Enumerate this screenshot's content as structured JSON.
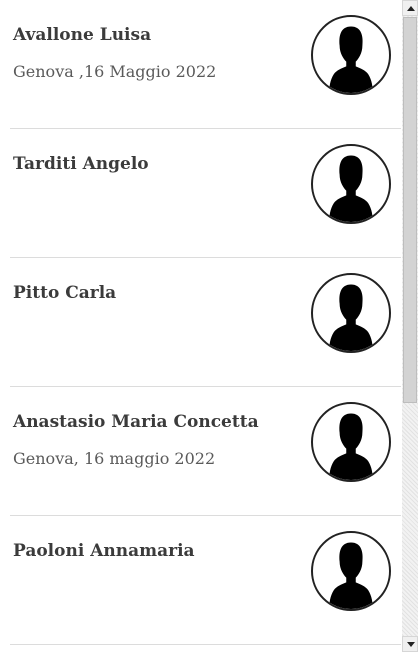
{
  "people": [
    {
      "name": "Avallone Luisa",
      "subtitle": "Genova ,16 Maggio 2022",
      "avatar_icon": "person-silhouette-icon"
    },
    {
      "name": "Tarditi Angelo",
      "subtitle": "",
      "avatar_icon": "person-silhouette-icon"
    },
    {
      "name": "Pitto Carla",
      "subtitle": "",
      "avatar_icon": "person-silhouette-icon"
    },
    {
      "name": "Anastasio Maria Concetta",
      "subtitle": "Genova, 16 maggio 2022",
      "avatar_icon": "person-silhouette-icon"
    },
    {
      "name": "Paoloni Annamaria",
      "subtitle": "",
      "avatar_icon": "person-silhouette-icon"
    }
  ]
}
